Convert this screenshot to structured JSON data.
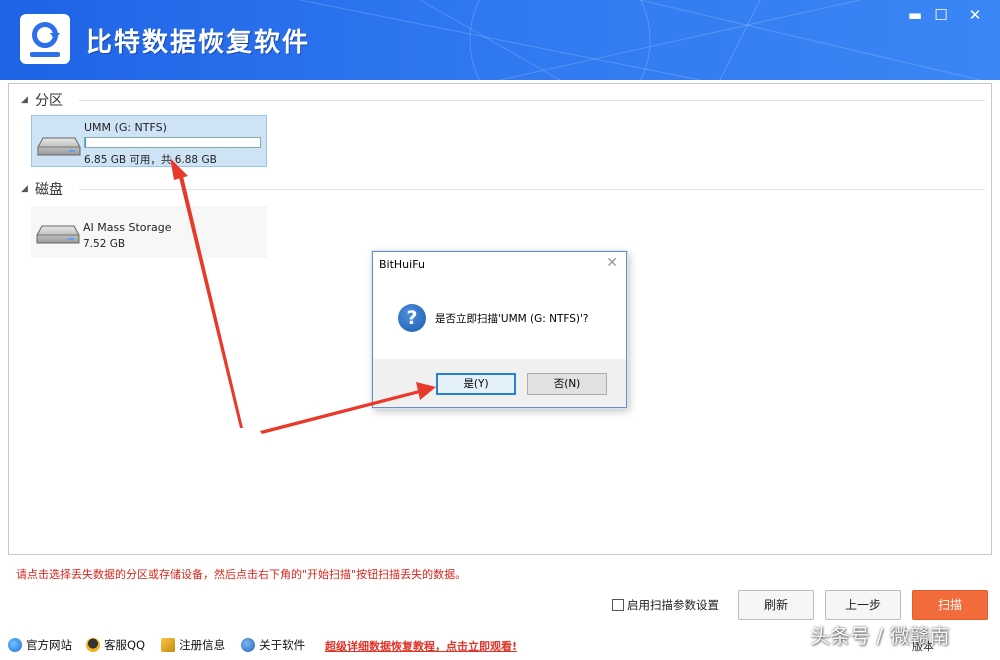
{
  "app": {
    "title": "比特数据恢复软件",
    "colors": {
      "header": "#2f77f0",
      "accent": "#f26b3a",
      "hint": "#d9261c",
      "selected": "#cfe3f7"
    }
  },
  "window_controls": {
    "minimize": "▬",
    "maximize": "☐",
    "close": "✕"
  },
  "sections": {
    "partitions": {
      "label": "分区",
      "items": [
        {
          "name": "UMM (G: NTFS)",
          "size_text": "6.85 GB 可用，共 6.88 GB",
          "used_fraction": 0.004
        }
      ]
    },
    "disks": {
      "label": "磁盘",
      "items": [
        {
          "name": "AI Mass Storage",
          "size_text": "7.52 GB"
        }
      ]
    }
  },
  "dialog": {
    "title": "BitHuiFu",
    "close_glyph": "✕",
    "icon_glyph": "?",
    "message": "是否立即扫描'UMM (G: NTFS)'?",
    "yes_label": "是(Y)",
    "no_label": "否(N)"
  },
  "hint": "请点击选择丢失数据的分区或存储设备，然后点击右下角的\"开始扫描\"按钮扫描丢失的数据。",
  "controls": {
    "scan_settings_label": "启用扫描参数设置",
    "refresh_label": "刷新",
    "back_label": "上一步",
    "scan_label": "扫描"
  },
  "footer": {
    "links": [
      {
        "label": "官方网站",
        "icon": "ie-icon"
      },
      {
        "label": "客服QQ",
        "icon": "qq-icon"
      },
      {
        "label": "注册信息",
        "icon": "key-icon"
      },
      {
        "label": "关于软件",
        "icon": "info-icon"
      }
    ],
    "promo": "超级详细数据恢复教程，点击立即观看!",
    "version_text": "版本"
  },
  "watermark": "头条号 / 微赣南"
}
